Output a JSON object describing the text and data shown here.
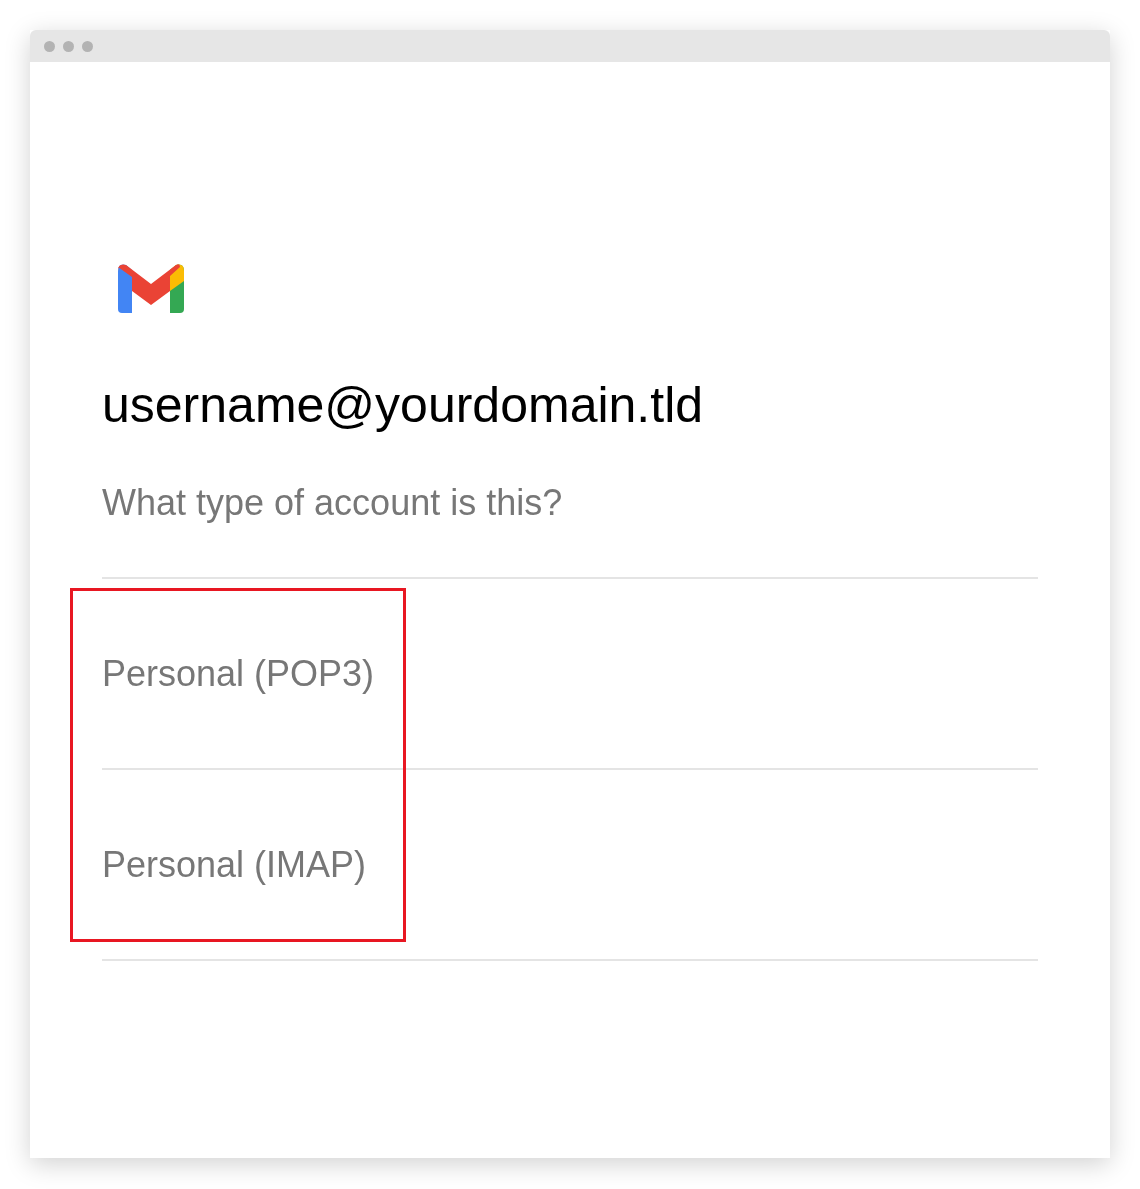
{
  "account": {
    "email": "username@yourdomain.tld",
    "question": "What type of account is this?"
  },
  "options": [
    {
      "label": "Personal (POP3)"
    },
    {
      "label": "Personal (IMAP)"
    }
  ],
  "annotation_frame": true
}
